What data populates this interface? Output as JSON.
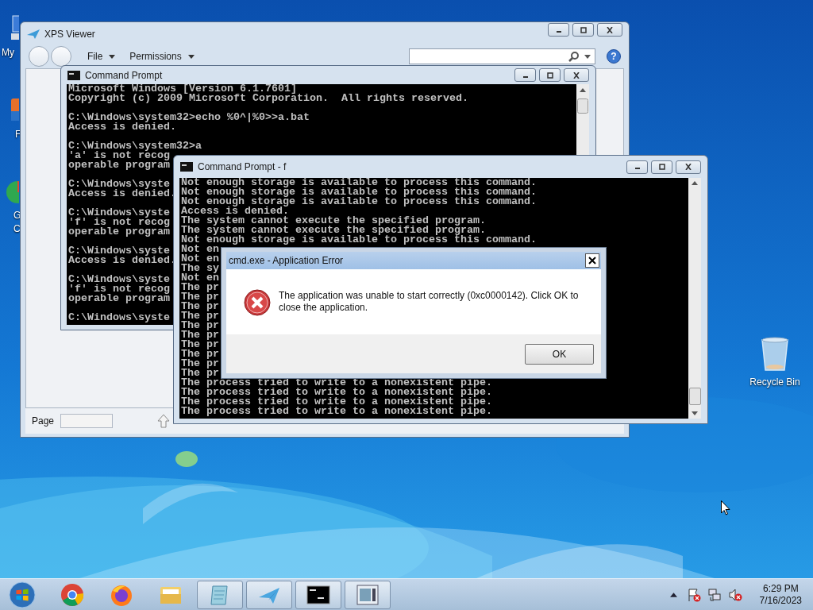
{
  "desktop": {
    "left_icons": [
      {
        "lines": [
          "My"
        ]
      },
      {
        "lines": [
          "F"
        ]
      },
      {
        "lines": [
          "G",
          "C"
        ]
      }
    ],
    "recycle_bin": {
      "label": "Recycle Bin"
    }
  },
  "xps_viewer": {
    "title": "XPS Viewer",
    "menus": [
      {
        "label": "File"
      },
      {
        "label": "Permissions"
      }
    ],
    "help": "?",
    "status_bar": {
      "page_label": "Page"
    }
  },
  "command_prompt_back": {
    "title": "Command Prompt",
    "blocks": [
      [
        "Microsoft Windows [Version 6.1.7601]",
        "Copyright (c) 2009 Microsoft Corporation.  All rights reserved."
      ],
      [
        "C:\\Windows\\system32>echo %0^|%0>>a.bat",
        "Access is denied."
      ],
      [
        "C:\\Windows\\system32>a",
        "'a' is not recog",
        "operable program"
      ],
      [
        "C:\\Windows\\syste",
        "Access is denied."
      ],
      [
        "C:\\Windows\\syste",
        "'f' is not recog",
        "operable program"
      ],
      [
        "C:\\Windows\\syste",
        "Access is denied."
      ],
      [
        "C:\\Windows\\syste",
        "'f' is not recog",
        "operable program"
      ],
      [
        "C:\\Windows\\syste"
      ]
    ]
  },
  "command_prompt_front": {
    "title": "Command Prompt - f",
    "lines": [
      "Not enough storage is available to process this command.",
      "Not enough storage is available to process this command.",
      "Not enough storage is available to process this command.",
      "Access is denied.",
      "The system cannot execute the specified program.",
      "The system cannot execute the specified program.",
      "Not enough storage is available to process this command.",
      "Not en",
      "Not en",
      "The sy",
      "Not en",
      "The pr",
      "The pr",
      "The pr",
      "The pr",
      "The pr",
      "The pr",
      "The pr",
      "The pr",
      "The pr",
      "The pr",
      "The process tried to write to a nonexistent pipe.",
      "The process tried to write to a nonexistent pipe.",
      "The process tried to write to a nonexistent pipe.",
      "The process tried to write to a nonexistent pipe."
    ]
  },
  "error_dialog": {
    "title": "cmd.exe - Application Error",
    "message": "The application was unable to start correctly (0xc0000142). Click OK to close the application.",
    "buttons": [
      "OK"
    ]
  },
  "taskbar": {
    "items": [
      {
        "kind": "chrome",
        "running": false
      },
      {
        "kind": "firefox",
        "running": false
      },
      {
        "kind": "explorer",
        "running": false
      },
      {
        "kind": "notepad",
        "running": true
      },
      {
        "kind": "xps",
        "running": true
      },
      {
        "kind": "console",
        "running": true
      },
      {
        "kind": "window",
        "running": true
      }
    ],
    "clock": {
      "time": "6:29 PM",
      "date": "7/16/2023"
    }
  }
}
